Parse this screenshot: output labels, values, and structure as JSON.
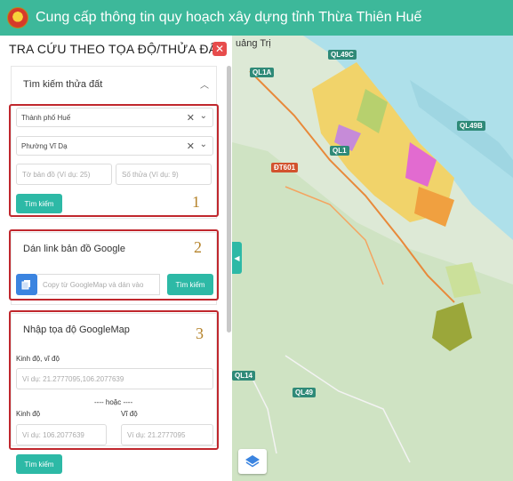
{
  "header": {
    "title": "Cung cấp thông tin quy hoạch xây dựng tỉnh Thừa Thiên Huế",
    "emblem_icon": "national-emblem-icon"
  },
  "panel": {
    "title": "TRA CỨU THEO TỌA ĐỘ/THỬA ĐẤT",
    "close_label": "✕",
    "land_search": {
      "title": "Tìm kiếm thửa đất",
      "city_value": "Thành phố Huế",
      "ward_value": "Phường Vĩ Dạ",
      "map_sheet_placeholder": "Tờ bản đồ (Ví dụ: 25)",
      "parcel_placeholder": "Số thửa (Ví dụ: 9)",
      "search_label": "Tìm kiếm",
      "marker": "1"
    },
    "google_link": {
      "title": "Dán link bản đồ Google",
      "input_placeholder": "Copy từ GoogleMap và dán vào",
      "search_label": "Tìm kiếm",
      "marker": "2"
    },
    "coords": {
      "title": "Nhập tọa độ GoogleMap",
      "latlng_label": "Kinh độ, vĩ độ",
      "latlng_placeholder": "Ví dụ: 21.2777095,106.2077639",
      "or_label": "---- hoặc ----",
      "lng_label": "Kinh độ",
      "lat_label": "Vĩ độ",
      "lng_placeholder": "Ví dụ: 106.2077639",
      "lat_placeholder": "Ví dụ: 21.2777095",
      "search_label": "Tìm kiếm",
      "marker": "3"
    }
  },
  "map": {
    "place_quang_tri": "uảng Trị",
    "roads": [
      "QL1A",
      "QL49C",
      "QL49B",
      "QL1",
      "QL14",
      "QL49",
      "ĐT601"
    ],
    "road_colors": {
      "primary": "#2f8a78",
      "secondary": "#d2522e"
    },
    "expand_icon": "chevron-left-icon",
    "layers_icon": "layers-icon"
  },
  "accent": "#2db9a6",
  "header_color": "#3db89a"
}
